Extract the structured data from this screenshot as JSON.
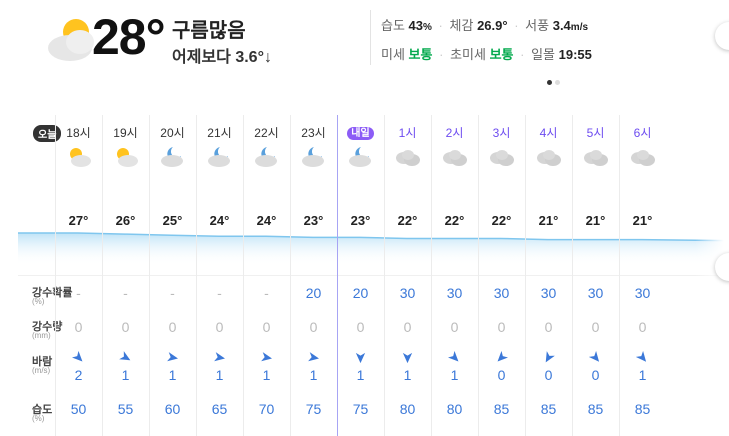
{
  "current": {
    "temp": "28°",
    "condition": "구름많음",
    "compare": "어제보다 3.6°↓",
    "icon": "sun-cloud-icon"
  },
  "details": {
    "humidity_label": "습도",
    "humidity_value": "43",
    "humidity_unit": "%",
    "feels_label": "체감",
    "feels_value": "26.9°",
    "wind_label": "서풍",
    "wind_value": "3.4",
    "wind_unit": "m/s",
    "dust_label": "미세",
    "dust_value": "보통",
    "fine_dust_label": "초미세",
    "fine_dust_value": "보통",
    "sunset_label": "일몰",
    "sunset_value": "19:55"
  },
  "labels": {
    "today": "오늘",
    "precip_prob": "강수확률",
    "precip_prob_unit": "(%)",
    "precip": "강수량",
    "precip_unit": "(mm)",
    "wind": "바람",
    "wind_unit": "(m/s)",
    "humidity": "습도",
    "humidity_unit": "(%)"
  },
  "hours": [
    {
      "time": "18시",
      "icon": "sun-cloud-icon",
      "temp": 27,
      "pop": "-",
      "rain": "0",
      "wind_dir": 135,
      "wind": "2",
      "hum": "50"
    },
    {
      "time": "19시",
      "icon": "sun-cloud-icon",
      "temp": 26,
      "pop": "-",
      "rain": "0",
      "wind_dir": 120,
      "wind": "1",
      "hum": "55"
    },
    {
      "time": "20시",
      "icon": "moon-cloud-icon",
      "temp": 25,
      "pop": "-",
      "rain": "0",
      "wind_dir": 100,
      "wind": "1",
      "hum": "60"
    },
    {
      "time": "21시",
      "icon": "moon-cloud-icon",
      "temp": 24,
      "pop": "-",
      "rain": "0",
      "wind_dir": 100,
      "wind": "1",
      "hum": "65"
    },
    {
      "time": "22시",
      "icon": "moon-cloud-icon",
      "temp": 24,
      "pop": "-",
      "rain": "0",
      "wind_dir": 100,
      "wind": "1",
      "hum": "70"
    },
    {
      "time": "23시",
      "icon": "moon-cloud-icon",
      "temp": 23,
      "pop": "20",
      "rain": "0",
      "wind_dir": 100,
      "wind": "1",
      "hum": "75"
    },
    {
      "time": "내일",
      "icon": "moon-cloud-icon",
      "temp": 23,
      "pop": "20",
      "rain": "0",
      "wind_dir": 180,
      "wind": "1",
      "hum": "75",
      "badge": true
    },
    {
      "time": "1시",
      "icon": "cloud-icon",
      "temp": 22,
      "pop": "30",
      "rain": "0",
      "wind_dir": 180,
      "wind": "1",
      "hum": "80",
      "next": true
    },
    {
      "time": "2시",
      "icon": "cloud-icon",
      "temp": 22,
      "pop": "30",
      "rain": "0",
      "wind_dir": 135,
      "wind": "1",
      "hum": "80",
      "next": true
    },
    {
      "time": "3시",
      "icon": "cloud-icon",
      "temp": 22,
      "pop": "30",
      "rain": "0",
      "wind_dir": 225,
      "wind": "0",
      "hum": "85",
      "next": true
    },
    {
      "time": "4시",
      "icon": "cloud-icon",
      "temp": 21,
      "pop": "30",
      "rain": "0",
      "wind_dir": 210,
      "wind": "0",
      "hum": "85",
      "next": true
    },
    {
      "time": "5시",
      "icon": "cloud-icon",
      "temp": 21,
      "pop": "30",
      "rain": "0",
      "wind_dir": 140,
      "wind": "0",
      "hum": "85",
      "next": true
    },
    {
      "time": "6시",
      "icon": "cloud-icon",
      "temp": 21,
      "pop": "30",
      "rain": "0",
      "wind_dir": 140,
      "wind": "1",
      "hum": "85",
      "next": true
    }
  ],
  "colors": {
    "accent": "#3b78d8",
    "good": "#03a94d",
    "tomorrow_badge": "#8c5cf6"
  }
}
